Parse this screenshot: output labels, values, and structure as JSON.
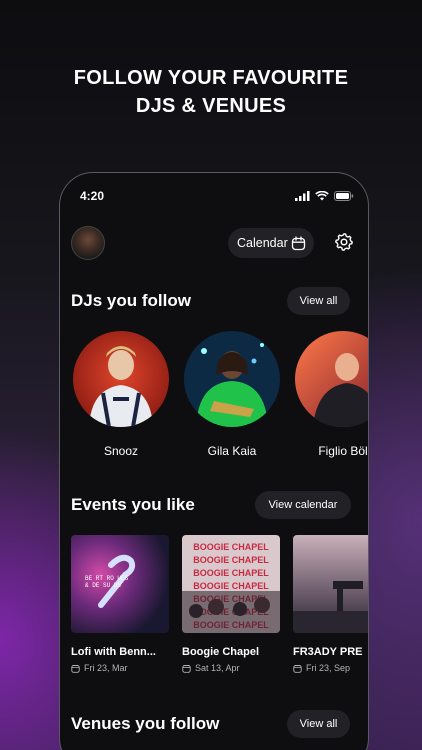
{
  "headline": {
    "line1": "FOLLOW YOUR FAVOURITE",
    "line2": "DJS & VENUES"
  },
  "status_bar": {
    "time": "4:20"
  },
  "header": {
    "calendar_label": "Calendar"
  },
  "djs_section": {
    "title": "DJs you follow",
    "action_label": "View all",
    "items": [
      {
        "name": "Snooz"
      },
      {
        "name": "Gila Kaia"
      },
      {
        "name": "Figlio Böl"
      }
    ]
  },
  "events_section": {
    "title": "Events you like",
    "action_label": "View calendar",
    "items": [
      {
        "title": "Lofi with Benn...",
        "date": "Fri 23, Mar",
        "poster_text": "BE RT RO UES\n& DE SU US"
      },
      {
        "title": "Boogie Chapel",
        "date": "Sat 13, Apr",
        "poster_text": "BOOGIE CHAPEL"
      },
      {
        "title": "FR3ADY PRE",
        "date": "Fri 23, Sep"
      }
    ]
  },
  "venues_section": {
    "title": "Venues you follow",
    "action_label": "View all"
  },
  "colors": {
    "pill_bg": "#222226",
    "phone_bg": "#0e0e10",
    "muted_text": "#b4b4b8"
  }
}
